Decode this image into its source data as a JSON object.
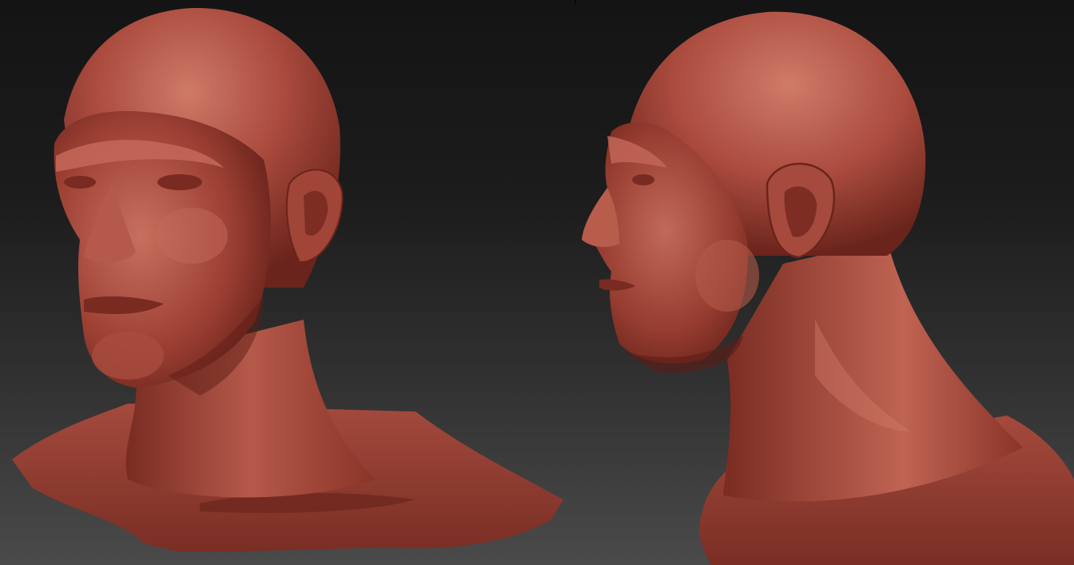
{
  "scene": {
    "subject": "clay-sculpt-head-bust",
    "views": [
      {
        "id": "three-quarter",
        "label": ""
      },
      {
        "id": "profile",
        "label": ""
      }
    ]
  },
  "colors": {
    "background_top": "#141414",
    "background_bottom": "#4a4a4a",
    "clay_base": "#a3463a",
    "clay_highlight": "#d27c6a",
    "clay_shadow": "#5e1d16"
  }
}
